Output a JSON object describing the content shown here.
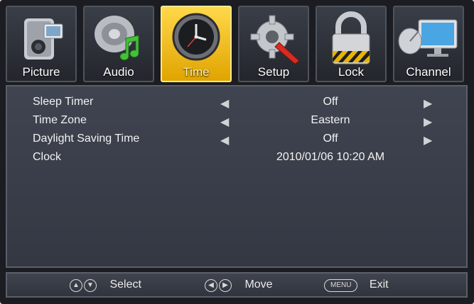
{
  "tabs": [
    {
      "label": "Picture",
      "icon": "camcorder-icon",
      "active": false
    },
    {
      "label": "Audio",
      "icon": "speaker-music-icon",
      "active": false
    },
    {
      "label": "Time",
      "icon": "clock-icon",
      "active": true
    },
    {
      "label": "Setup",
      "icon": "gear-wrench-icon",
      "active": false
    },
    {
      "label": "Lock",
      "icon": "padlock-icon",
      "active": false
    },
    {
      "label": "Channel",
      "icon": "satellite-monitor-icon",
      "active": false
    }
  ],
  "settings": [
    {
      "name": "Sleep Timer",
      "value": "Off",
      "arrows": true
    },
    {
      "name": "Time Zone",
      "value": "Eastern",
      "arrows": true
    },
    {
      "name": "Daylight Saving Time",
      "value": "Off",
      "arrows": true
    },
    {
      "name": "Clock",
      "value": "2010/01/06 10:20 AM",
      "arrows": false
    }
  ],
  "footer": {
    "select_label": "Select",
    "move_label": "Move",
    "menu_key": "MENU",
    "exit_label": "Exit"
  },
  "colors": {
    "active_tab": "#f0b800",
    "panel": "#3a3e48",
    "background": "#1b1d22"
  }
}
